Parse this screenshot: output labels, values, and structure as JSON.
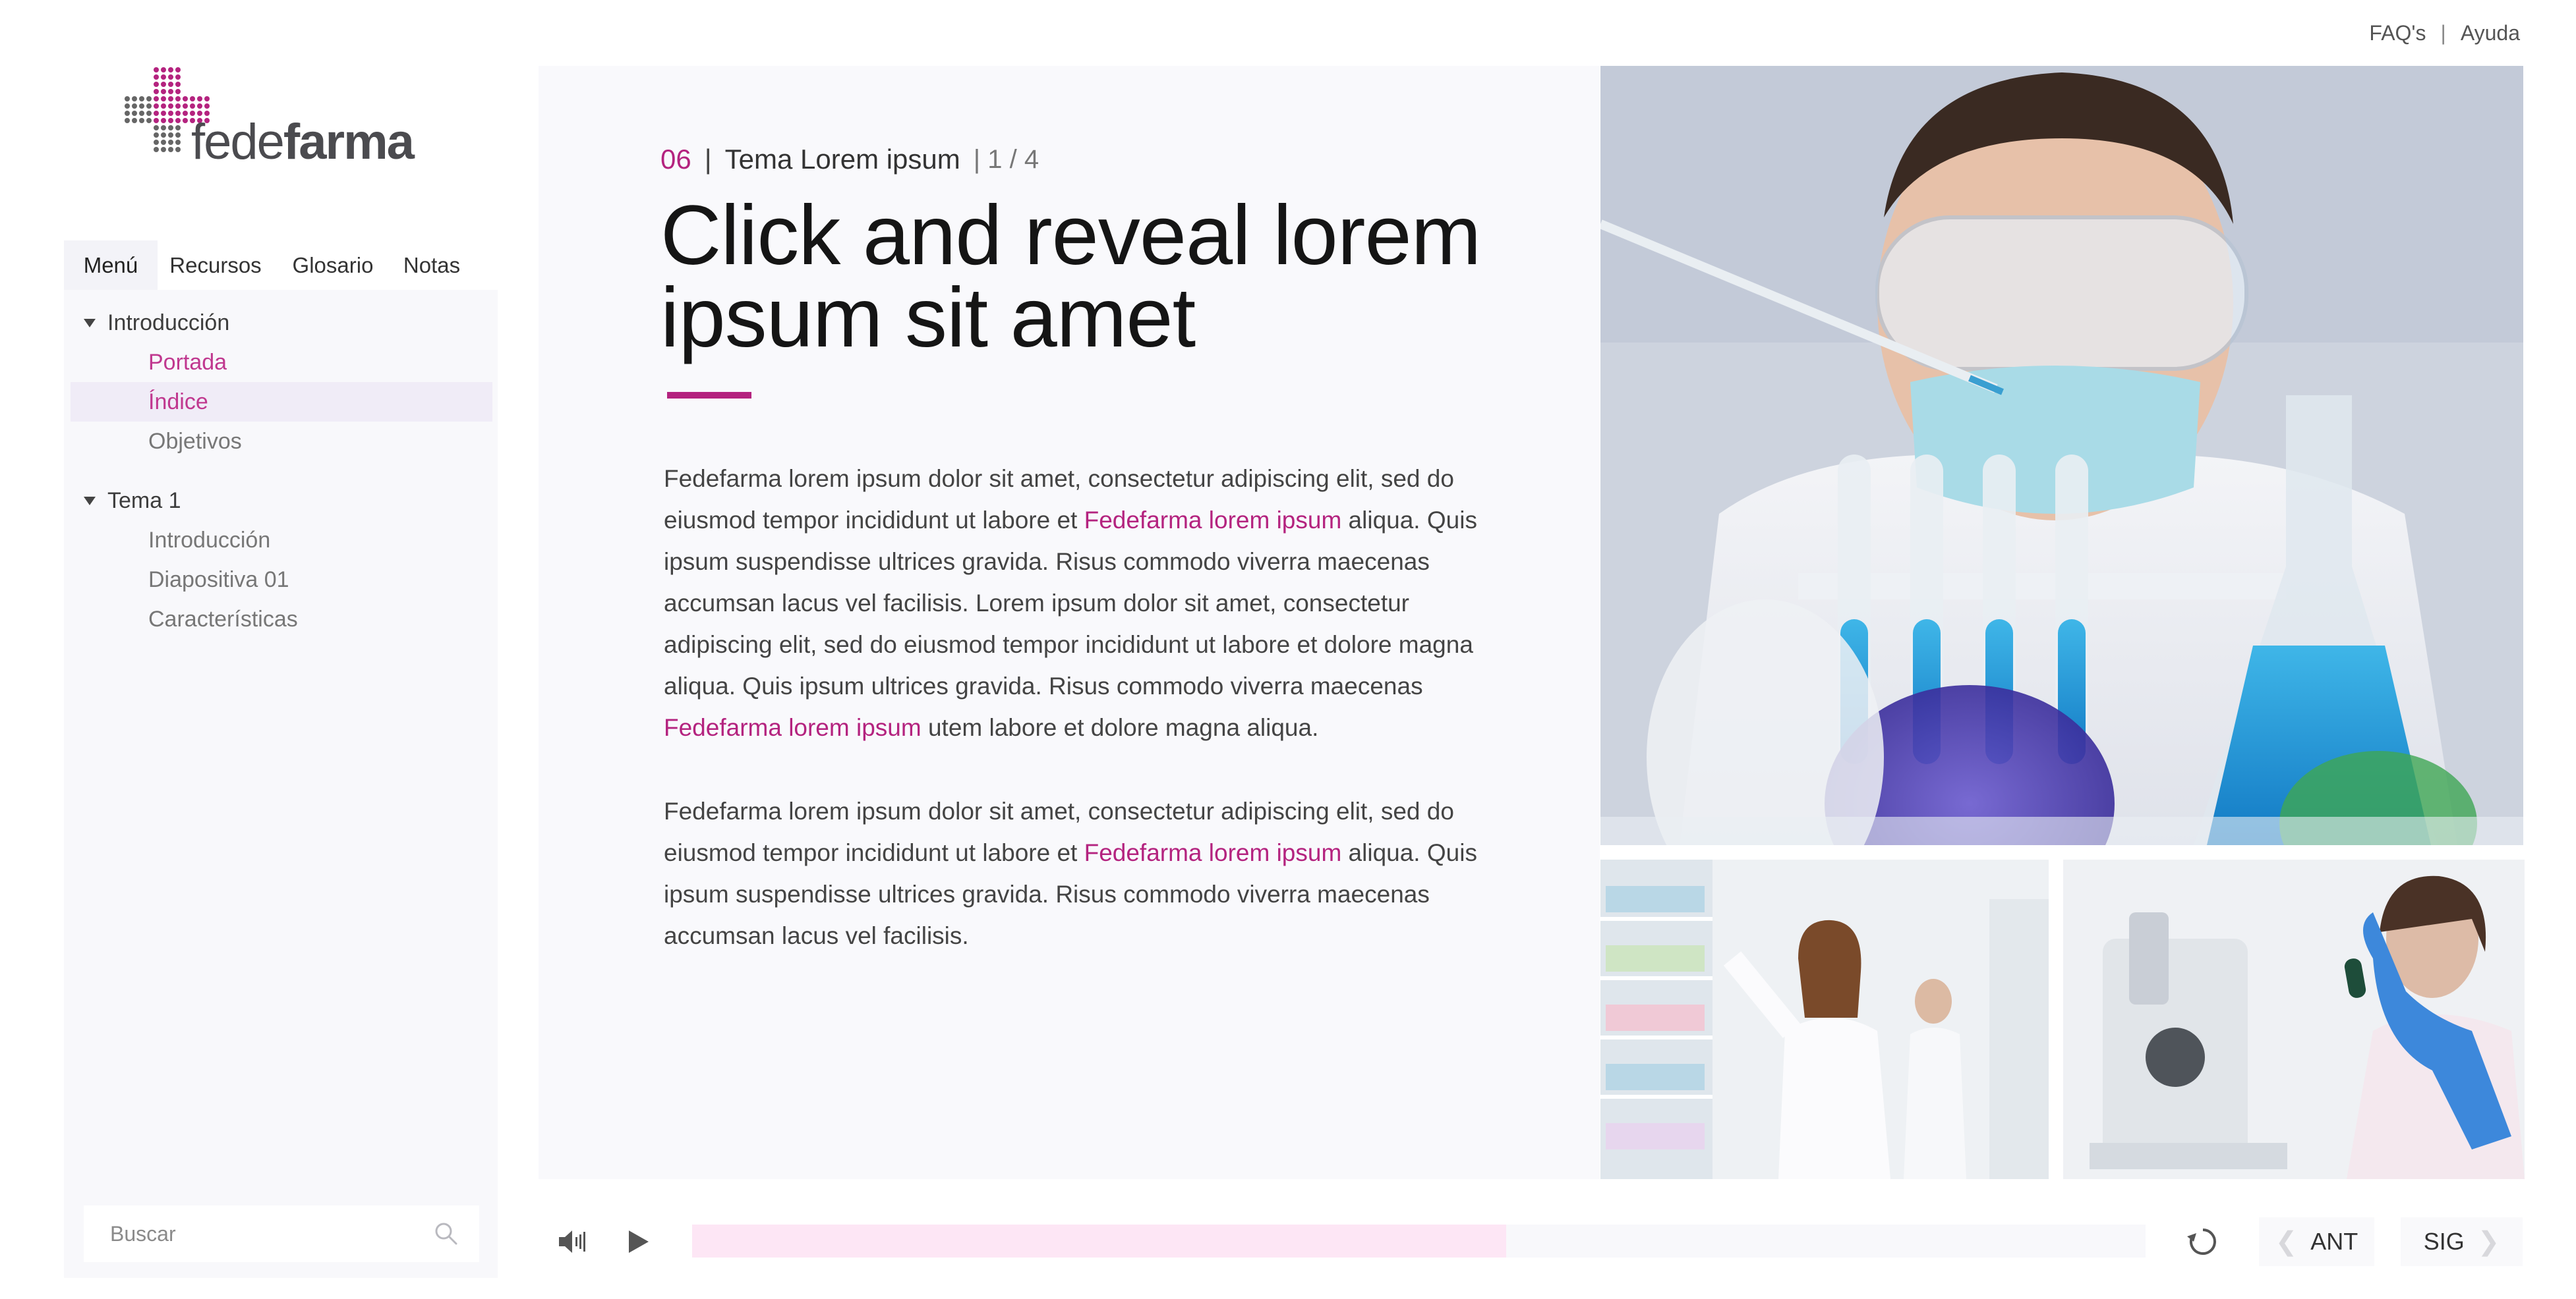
{
  "header": {
    "links": [
      {
        "label": "FAQ's"
      },
      {
        "label": "Ayuda"
      }
    ],
    "separator": "|"
  },
  "brand": {
    "name_light": "fede",
    "name_bold": "farma",
    "accent_color": "#b4237f"
  },
  "sidebar": {
    "tabs": [
      {
        "label": "Menú",
        "active": true
      },
      {
        "label": "Recursos"
      },
      {
        "label": "Glosario"
      },
      {
        "label": "Notas"
      }
    ],
    "groups": [
      {
        "label": "Introducción",
        "expanded": true,
        "items": [
          {
            "label": "Portada",
            "state": "visited"
          },
          {
            "label": "Índice",
            "state": "current"
          },
          {
            "label": "Objetivos",
            "state": "default"
          }
        ]
      },
      {
        "label": "Tema 1",
        "expanded": true,
        "items": [
          {
            "label": "Introducción",
            "state": "default"
          },
          {
            "label": "Diapositiva 01",
            "state": "default"
          },
          {
            "label": "Características",
            "state": "default"
          }
        ]
      }
    ],
    "search": {
      "placeholder": "Buscar",
      "icon": "search-icon"
    }
  },
  "content": {
    "breadcrumb": {
      "number": "06",
      "separator": "|",
      "topic": "Tema Lorem ipsum",
      "page": "| 1 / 4"
    },
    "title": "Click and reveal lorem ipsum sit amet",
    "paragraphs": [
      [
        {
          "text": "Fedefarma lorem ipsum dolor sit amet, consectetur adipiscing elit, sed do eiusmod tempor incididunt ut labore et "
        },
        {
          "text": "Fedefarma lorem ipsum",
          "highlight": true
        },
        {
          "text": " aliqua. Quis ipsum suspendisse ultrices gravida. Risus commodo viverra maecenas accumsan lacus vel facilisis.  Lorem ipsum dolor sit amet, consectetur adipiscing elit, sed do eiusmod tempor incididunt ut labore et dolore magna aliqua. Quis ipsum ultrices gravida. Risus commodo viverra maecenas "
        },
        {
          "text": "Fedefarma lorem ipsum",
          "highlight": true
        },
        {
          "text": " utem labore et dolore magna aliqua."
        }
      ],
      [
        {
          "text": "Fedefarma lorem ipsum dolor sit amet, consectetur adipiscing elit, sed do eiusmod tempor incididunt ut labore et "
        },
        {
          "text": "Fedefarma lorem ipsum",
          "highlight": true
        },
        {
          "text": " aliqua. Quis ipsum suspendisse ultrices gravida. Risus commodo viverra maecenas accumsan lacus vel facilisis."
        }
      ]
    ]
  },
  "player": {
    "icons": [
      "speaker-icon",
      "play-icon",
      "replay-icon"
    ],
    "progress": 0.56,
    "prev_label": "ANT",
    "next_label": "SIG"
  }
}
